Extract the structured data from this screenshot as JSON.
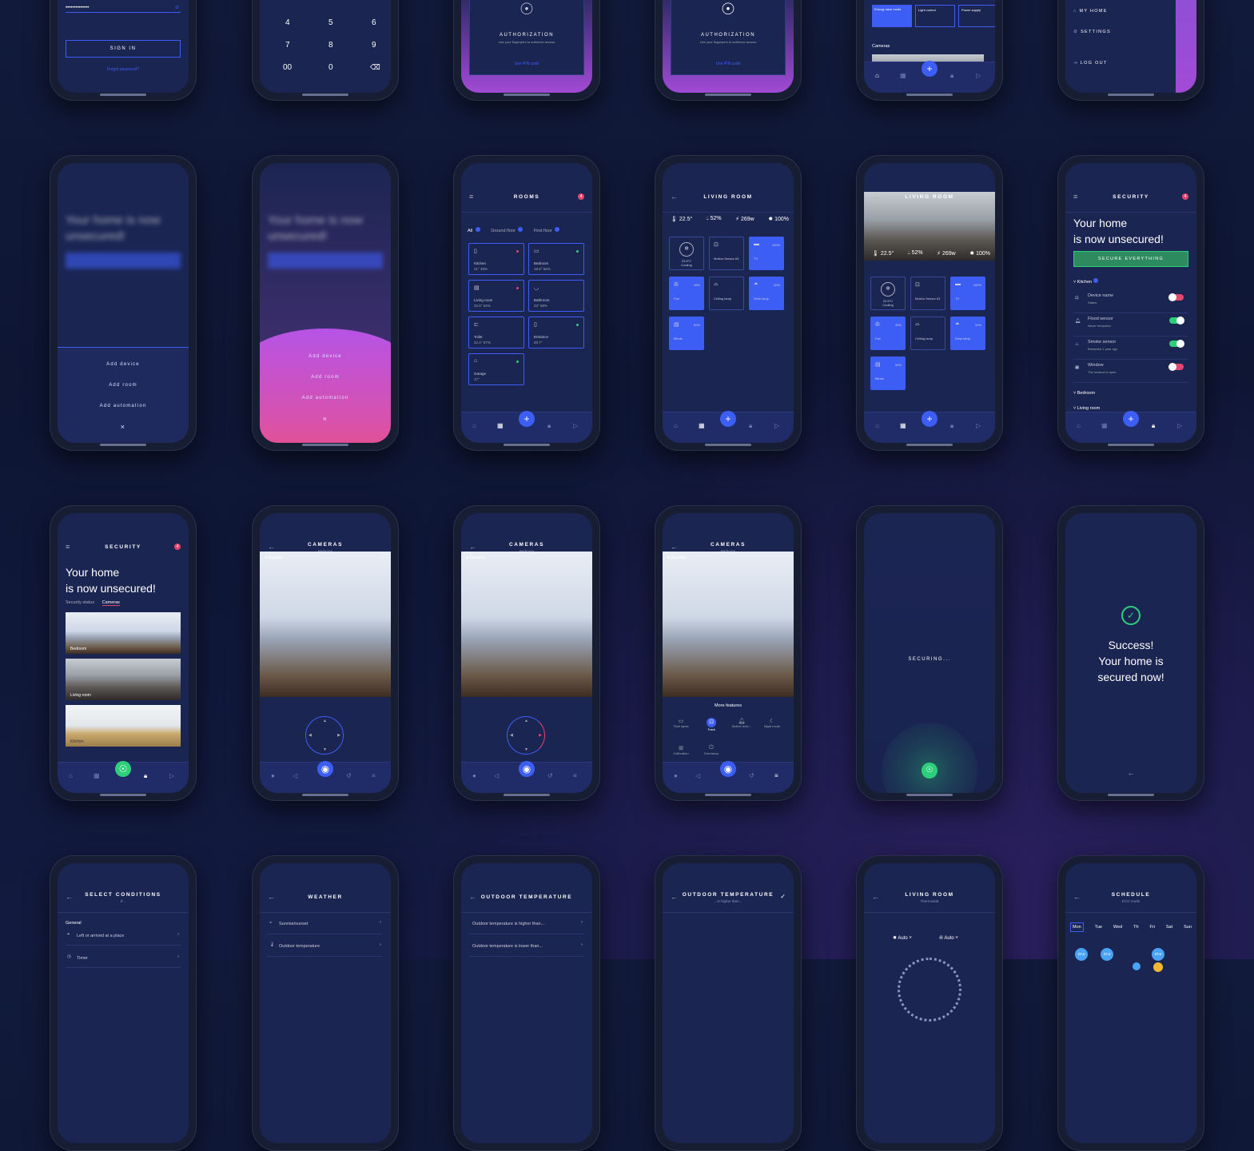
{
  "row1": {
    "signin": {
      "button": "SIGN IN",
      "forgot": "Forgot password?",
      "password_mask": "••••••••••••••"
    },
    "keypad": {
      "keys": [
        "4",
        "5",
        "6",
        "7",
        "8",
        "9",
        "00",
        "0"
      ],
      "backspace_icon": "backspace-icon"
    },
    "auth1": {
      "title": "AUTHORIZATION",
      "subtitle": "Use your fingerprint to authorize access",
      "pin_link": "Use PIN code"
    },
    "auth2": {
      "title": "AUTHORIZATION",
      "subtitle": "Use your fingerprint to authorize access",
      "pin_link": "Use PIN code"
    },
    "home": {
      "modes": [
        "Energy save mode",
        "Light control",
        "Power supply"
      ],
      "cameras_label": "Cameras"
    },
    "drawer": {
      "items": [
        "MY HOME",
        "SETTINGS",
        "LOG OUT"
      ]
    }
  },
  "add_menu": {
    "items": [
      "Add device",
      "Add room",
      "Add automation"
    ],
    "close": "×"
  },
  "blur_bg": {
    "title": "Your home is now unsecured!"
  },
  "rooms": {
    "title": "ROOMS",
    "badge": "4",
    "filters": [
      "All",
      "Ground floor",
      "First floor"
    ],
    "list": [
      {
        "name": "Kitchen",
        "stats": "21° 49%"
      },
      {
        "name": "Bedroom",
        "stats": "18.5° 56%"
      },
      {
        "name": "Living room",
        "stats": "22.5° 52%"
      },
      {
        "name": "Bathroom",
        "stats": "23° 68%"
      },
      {
        "name": "Toilet",
        "stats": "22.4° 57%"
      },
      {
        "name": "Entrance",
        "stats": "20.7°"
      },
      {
        "name": "Garage",
        "stats": "17°"
      }
    ]
  },
  "living_room": {
    "title": "LIVING ROOM",
    "stats": [
      "22.5°",
      "52%",
      "269w",
      "100%"
    ],
    "devices": [
      {
        "name": "Cooling",
        "value": "22.5°C",
        "icon": "snowflake-icon",
        "on": false
      },
      {
        "name": "Motion Sensor #3",
        "value": "",
        "icon": "motion-icon",
        "on": false
      },
      {
        "name": "TV",
        "value": "100%",
        "icon": "tv-icon",
        "on": true
      },
      {
        "name": "Fan",
        "value": "49%",
        "icon": "fan-icon",
        "on": true
      },
      {
        "name": "Ceiling lamp",
        "value": "",
        "icon": "lamp-icon",
        "on": false
      },
      {
        "name": "Desk lamp",
        "value": "20%",
        "icon": "desk-lamp-icon",
        "on": true
      },
      {
        "name": "Blinds",
        "value": "50%",
        "icon": "blinds-icon",
        "on": true
      }
    ]
  },
  "security": {
    "title": "SECURITY",
    "badge": "4",
    "heading1": "Your home",
    "heading2": "is now unsecured!",
    "button": "SECURE EVERYTHING",
    "group": "Kitchen",
    "rows": [
      {
        "name": "Device name",
        "status": "Status",
        "on": false
      },
      {
        "name": "Flood sensor",
        "status": "Never breached",
        "on": true
      },
      {
        "name": "Smoke sensor",
        "status": "Breached 1 year ago",
        "on": true
      },
      {
        "name": "Window",
        "status": "The window is open",
        "on": false
      }
    ],
    "groups_collapsed": [
      "Bedroom",
      "Living room"
    ],
    "tabs": [
      "Security status",
      "Cameras"
    ],
    "cams": [
      "Bedroom",
      "Living room",
      "Kitchen"
    ]
  },
  "cameras": {
    "title": "CAMERAS",
    "subtitle": "Bedroom",
    "status": "Secured",
    "more": "More features",
    "features": [
      "Time lapse",
      "Track",
      "Motion dete...",
      "Night mode",
      "Calibration",
      "Dormancy"
    ]
  },
  "securing": {
    "label": "SECURING..."
  },
  "success": {
    "line1": "Success!",
    "line2": "Your home is",
    "line3": "secured now!"
  },
  "row4": {
    "conditions": {
      "title": "SELECT CONDITIONS",
      "subtitle": "If...",
      "group": "General",
      "items": [
        "Left or arrived at a place",
        "Timer"
      ]
    },
    "weather": {
      "title": "WEATHER",
      "items": [
        "Sunrise/sunset",
        "Outdoor temperature"
      ]
    },
    "outdoor1": {
      "title": "OUTDOOR TEMPERATURE",
      "items": [
        "Outdoor temperature is higher than...",
        "Outdoor temperature is lower than..."
      ]
    },
    "outdoor2": {
      "title": "OUTDOOR TEMPERATURE",
      "subtitle": "...is higher than..."
    },
    "thermostat": {
      "title": "LIVING ROOM",
      "subtitle": "Thermostat",
      "modes": [
        "Auto",
        "Auto"
      ]
    },
    "schedule": {
      "title": "SCHEDULE",
      "subtitle": "ECO mode",
      "days": [
        "Mon",
        "Tue",
        "Wed",
        "Th",
        "Fri",
        "Sat",
        "Sun"
      ],
      "values": [
        "23.5",
        "23.5",
        "23.5"
      ]
    }
  },
  "colors": {
    "accent": "#3d5ef5",
    "green": "#2ecf7a",
    "red": "#e0476e",
    "purple": "#a14ad6"
  }
}
